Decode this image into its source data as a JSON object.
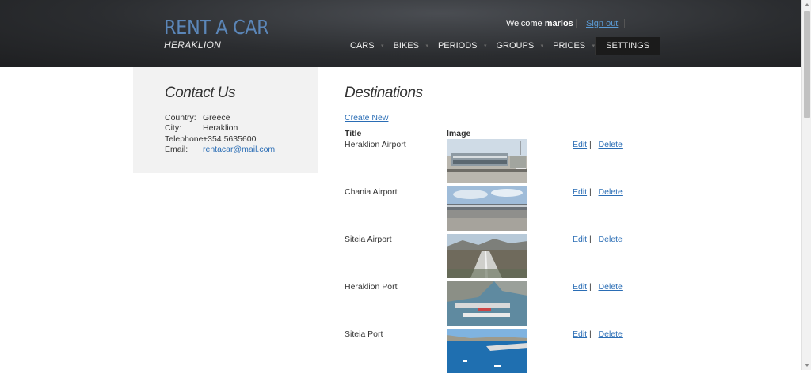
{
  "logo": {
    "title": "RENT A CAR",
    "subtitle": "HERAKLION"
  },
  "user": {
    "welcome_prefix": "Welcome",
    "username": "marios",
    "signout": "Sign out"
  },
  "nav": [
    "CARS",
    "BIKES",
    "PERIODS",
    "GROUPS",
    "PRICES",
    "SETTINGS"
  ],
  "contact": {
    "heading": "Contact Us",
    "rows": [
      {
        "label": "Country:",
        "value": "Greece"
      },
      {
        "label": "City:",
        "value": "Heraklion"
      },
      {
        "label": "Telephone:",
        "value": "+354 5635600"
      },
      {
        "label": "Email:",
        "value": "rentacar@mail.com"
      }
    ]
  },
  "destinations": {
    "heading": "Destinations",
    "create_new": "Create New",
    "col_title": "Title",
    "col_image": "Image",
    "edit": "Edit",
    "sep": "|",
    "delete": "Delete",
    "rows": [
      {
        "title": "Heraklion Airport"
      },
      {
        "title": "Chania Airport"
      },
      {
        "title": "Siteia Airport"
      },
      {
        "title": "Heraklion Port"
      },
      {
        "title": "Siteia Port"
      }
    ]
  }
}
